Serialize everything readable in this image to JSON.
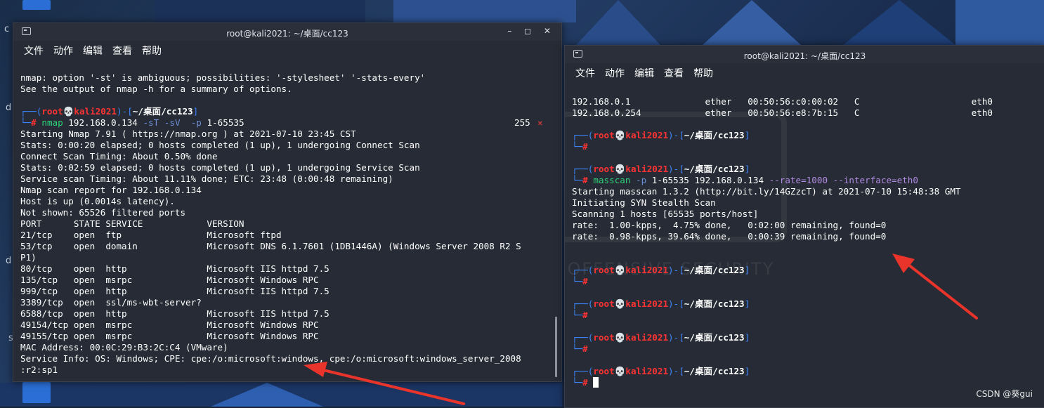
{
  "desktop": {
    "labels": [
      "c",
      "d",
      "d",
      "s"
    ],
    "watermark": "CSDN @葵gui",
    "logo_text": "BY OFFENSIVE SECURITY"
  },
  "left_window": {
    "title": "root@kali2021: ~/桌面/cc123",
    "controls": "– ◻ ✕",
    "menu": [
      "文件",
      "动作",
      "编辑",
      "查看",
      "帮助"
    ],
    "prompt": {
      "user": "root",
      "skull": "💀",
      "host": "kali2021",
      "path": "~/桌面/cc123"
    },
    "lines_pre": [
      "nmap: option '-st' is ambiguous; possibilities: '-stylesheet' '-stats-every'",
      "See the output of nmap -h for a summary of options."
    ],
    "cmd": {
      "prog": "nmap",
      "target": "192.168.0.134",
      "flags": "-sT -sV",
      "pflag": "-p",
      "range": "1-65535",
      "status": "255",
      "status_icon": "✕"
    },
    "output": [
      "Starting Nmap 7.91 ( https://nmap.org ) at 2021-07-10 23:45 CST",
      "Stats: 0:00:20 elapsed; 0 hosts completed (1 up), 1 undergoing Connect Scan",
      "Connect Scan Timing: About 0.50% done",
      "Stats: 0:02:59 elapsed; 0 hosts completed (1 up), 1 undergoing Service Scan",
      "Service scan Timing: About 11.11% done; ETC: 23:48 (0:00:48 remaining)",
      "Nmap scan report for 192.168.0.134",
      "Host is up (0.0014s latency).",
      "Not shown: 65526 filtered ports",
      "PORT      STATE SERVICE            VERSION",
      "21/tcp    open  ftp                Microsoft ftpd",
      "53/tcp    open  domain             Microsoft DNS 6.1.7601 (1DB1446A) (Windows Server 2008 R2 S",
      "P1)",
      "80/tcp    open  http               Microsoft IIS httpd 7.5",
      "135/tcp   open  msrpc              Microsoft Windows RPC",
      "999/tcp   open  http               Microsoft IIS httpd 7.5",
      "3389/tcp  open  ssl/ms-wbt-server?",
      "6588/tcp  open  http               Microsoft IIS httpd 7.5",
      "49154/tcp open  msrpc              Microsoft Windows RPC",
      "49155/tcp open  msrpc              Microsoft Windows RPC",
      "MAC Address: 00:0C:29:B3:2C:C4 (VMware)",
      "Service Info: OS: Windows; CPE: cpe:/o:microsoft:windows, cpe:/o:microsoft:windows_server_2008",
      ":r2:sp1"
    ]
  },
  "right_window": {
    "title": "root@kali2021: ~/桌面/cc123",
    "menu": [
      "文件",
      "动作",
      "编辑",
      "查看",
      "帮助"
    ],
    "arp": [
      "192.168.0.1              ether   00:50:56:c0:00:02   C                     eth0",
      "192.168.0.254            ether   00:50:56:e8:7b:15   C                     eth0"
    ],
    "cmd": {
      "prog": "masscan",
      "pflag": "-p",
      "range": "1-65535",
      "target": "192.168.0.134",
      "opts": "--rate=1000 --interface=eth0"
    },
    "output": [
      "Starting masscan 1.3.2 (http://bit.ly/14GZzcT) at 2021-07-10 15:48:38 GMT",
      "Initiating SYN Stealth Scan",
      "Scanning 1 hosts [65535 ports/host]",
      "rate:  1.00-kpps,  4.75% done,   0:02:00 remaining, found=0",
      "rate:  0.98-kpps, 39.64% done,   0:00:39 remaining, found=0"
    ]
  },
  "colors": {
    "accent_blue": "#3d86ff",
    "prompt_red": "#ff3333",
    "cmd_green": "#2fd27a",
    "arrow_red": "#e8342a"
  }
}
